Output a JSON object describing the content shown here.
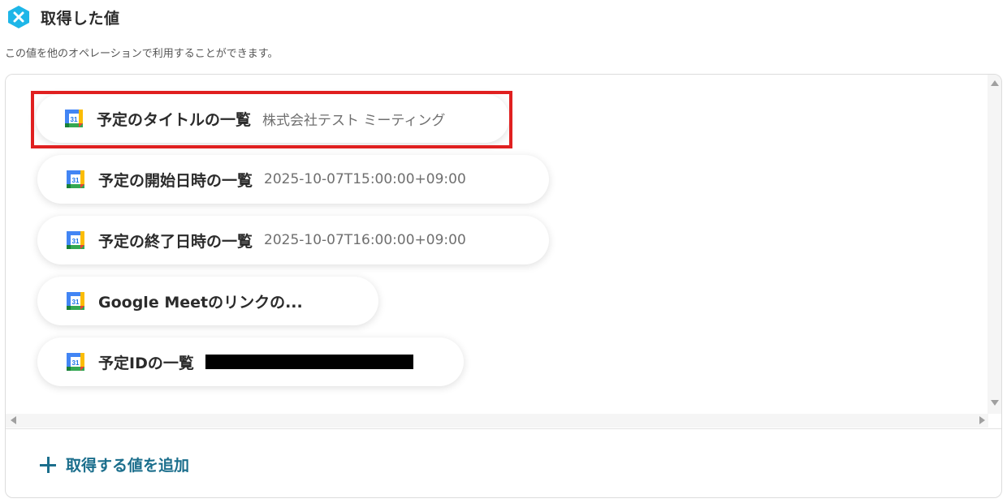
{
  "section": {
    "title": "取得した値",
    "description": "この値を他のオペレーションで利用することができます。"
  },
  "items": [
    {
      "label": "予定のタイトルの一覧",
      "value": "株式会社テスト ミーティング",
      "icon": "google-calendar-icon",
      "selected": true
    },
    {
      "label": "予定の開始日時の一覧",
      "value": "2025-10-07T15:00:00+09:00",
      "icon": "google-calendar-icon"
    },
    {
      "label": "予定の終了日時の一覧",
      "value": "2025-10-07T16:00:00+09:00",
      "icon": "google-calendar-icon"
    },
    {
      "label": "Google Meetのリンクの...",
      "value": "",
      "icon": "google-calendar-icon"
    },
    {
      "label": "予定IDの一覧",
      "value": "",
      "icon": "google-calendar-icon",
      "redacted": true
    }
  ],
  "add_button": {
    "label": "取得する値を追加",
    "icon": "plus-icon"
  },
  "colors": {
    "accent": "#1b6e8c",
    "selection": "#e02020",
    "logo": "#1eb6e8"
  }
}
